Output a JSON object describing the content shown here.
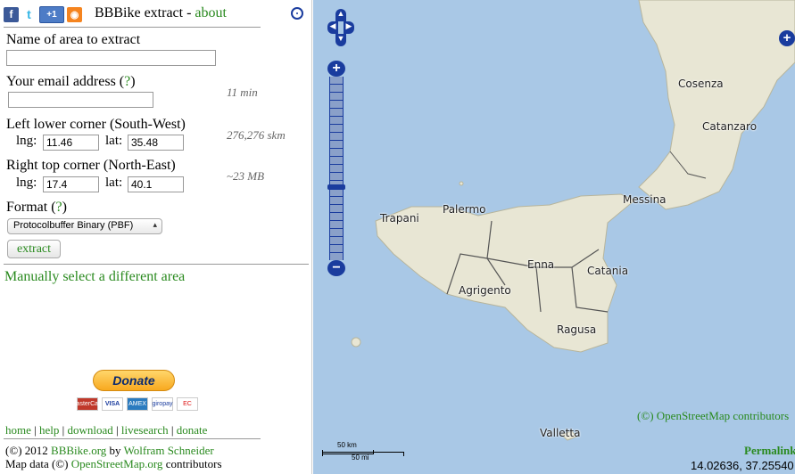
{
  "header": {
    "icons": [
      "facebook-icon",
      "twitter-icon",
      "google-plus-icon",
      "rss-icon"
    ],
    "gplus_label": "+1",
    "title": "BBBike extract - ",
    "about_link": "about"
  },
  "form": {
    "area_label": "Name of area to extract",
    "area_value": "",
    "email_label": "Your email address (",
    "email_help": "?",
    "email_close": ")",
    "email_value": "",
    "time_estimate": "11 min",
    "sw_label": "Left lower corner (South-West)",
    "sw_lng_label": "lng:",
    "sw_lng_value": "11.46",
    "sw_lat_label": "lat:",
    "sw_lat_value": "35.48",
    "area_estimate": "276,276 skm",
    "ne_label": "Right top corner (North-East)",
    "ne_lng_label": "lng:",
    "ne_lng_value": "17.4",
    "ne_lat_label": "lat:",
    "ne_lat_value": "40.1",
    "size_estimate": "~23 MB",
    "format_label": "Format (",
    "format_help": "?",
    "format_close": ")",
    "format_value": "Protocolbuffer Binary (PBF)",
    "extract_button": "extract",
    "manual_select": "Manually select a different area"
  },
  "footer": {
    "donate_label": "Donate",
    "cards": [
      "MasterCard",
      "VISA",
      "AMEX",
      "giropay",
      "EC"
    ],
    "links": [
      "home",
      "help",
      "download",
      "livesearch",
      "donate"
    ],
    "copyright_prefix": "(©) 2012 ",
    "bbbike_link": "BBBike.org",
    "by": " by ",
    "author_link": "Wolfram Schneider",
    "mapdata_prefix": "Map data (©) ",
    "osm_link": "OpenStreetMap.org",
    "contributors": " contributors"
  },
  "map": {
    "places": [
      "Cosenza",
      "Catanzaro",
      "Messina",
      "Palermo",
      "Trapani",
      "Enna",
      "Catania",
      "Agrigento",
      "Ragusa",
      "Valletta"
    ],
    "attribution": "(©) OpenStreetMap contributors",
    "permalink": "Permalink",
    "coordinates": "14.02636, 37.25540",
    "scale_km": "50 km",
    "scale_mi": "50 mi"
  },
  "colors": {
    "link_green": "#2a8a1f",
    "control_blue": "#1a3c9e",
    "sea": "#a7c7e4",
    "land": "#e8e6d4"
  }
}
